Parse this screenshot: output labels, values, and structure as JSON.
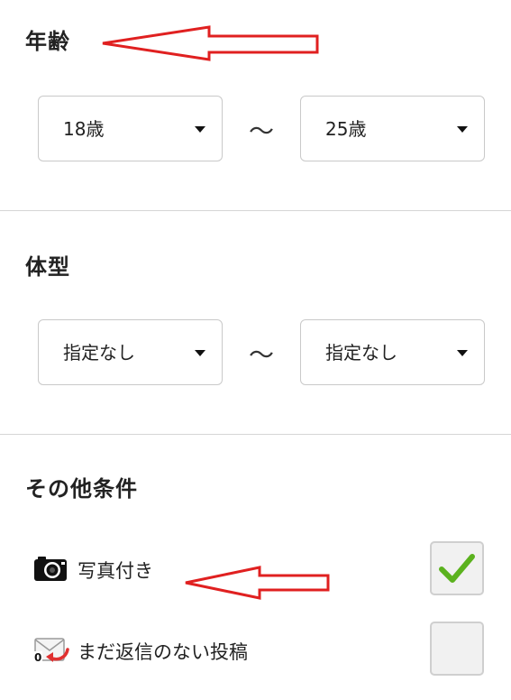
{
  "age": {
    "title": "年齢",
    "min": "18歳",
    "separator": "〜",
    "max": "25歳"
  },
  "body_type": {
    "title": "体型",
    "min": "指定なし",
    "separator": "〜",
    "max": "指定なし"
  },
  "other": {
    "title": "その他条件",
    "options": [
      {
        "label": "写真付き",
        "icon": "camera-icon",
        "checked": true
      },
      {
        "label": "まだ返信のない投稿",
        "icon": "mail-reply-icon",
        "badge": "0",
        "checked": false
      }
    ]
  },
  "colors": {
    "annotation_arrow": "#e02020",
    "check": "#5bb21e",
    "border": "#c9c9c9"
  }
}
